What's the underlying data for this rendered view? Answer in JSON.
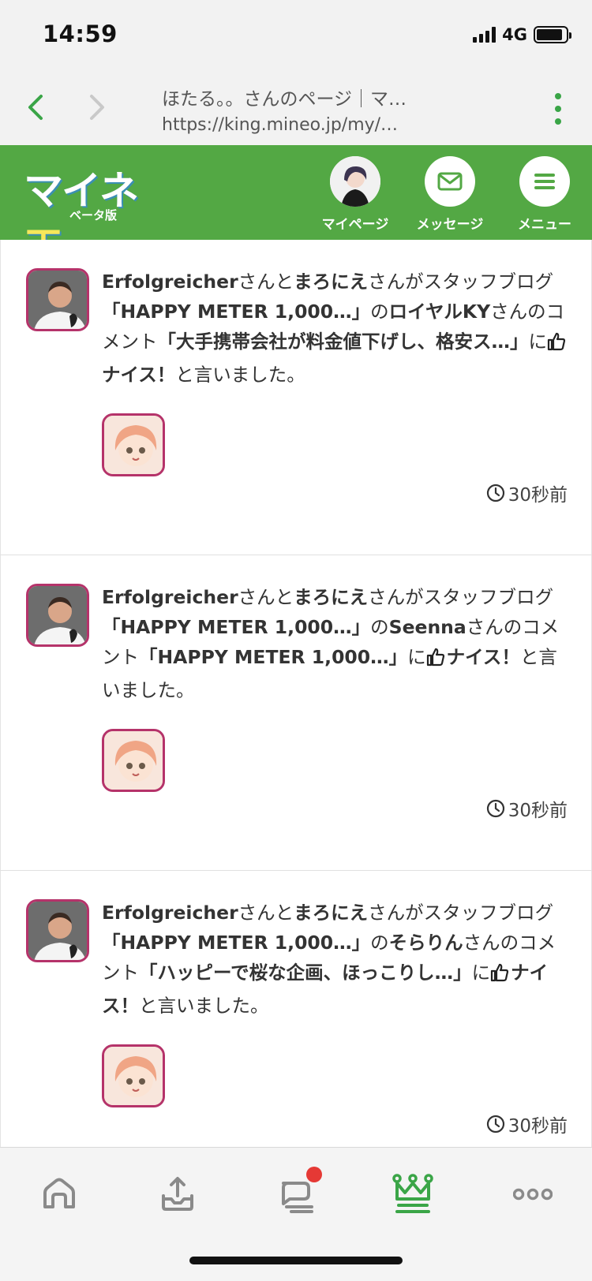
{
  "status": {
    "time": "14:59",
    "network": "4G"
  },
  "browser": {
    "page_title": "ほたる。。さんのページ｜マ…",
    "url": "https://king.mineo.jp/my/…"
  },
  "header": {
    "logo_text_a": "マイネ",
    "logo_text_b": "王",
    "logo_sub": "ベータ版",
    "mypage_label": "マイページ",
    "message_label": "メッセージ",
    "menu_label": "メニュー"
  },
  "feed": [
    {
      "actor1": "Erfolgreicher",
      "t1": "さんと",
      "actor2": "まろにえ",
      "t2": "さんがスタッフブログ",
      "blog": "「HAPPY METER 1,000…」",
      "t3": "の",
      "commenter": "ロイヤルKY",
      "t4": "さんのコメント",
      "comment": "「大手携帯会社が料金値下げし、格安ス…」",
      "t5": "に",
      "nice": "ナイス！",
      "t6": "と言いました。",
      "time": "30秒前"
    },
    {
      "actor1": "Erfolgreicher",
      "t1": "さんと",
      "actor2": "まろにえ",
      "t2": "さんがスタッフブログ",
      "blog": "「HAPPY METER 1,000…」",
      "t3": "の",
      "commenter": "Seenna",
      "t4": "さんのコメント",
      "comment": "「HAPPY METER 1,000…」",
      "t5": "に",
      "nice": "ナイス！",
      "t6": "と言いました。",
      "time": "30秒前"
    },
    {
      "actor1": "Erfolgreicher",
      "t1": "さんと",
      "actor2": "まろにえ",
      "t2": "さんがスタッフブログ",
      "blog": "「HAPPY METER 1,000…」",
      "t3": "の",
      "commenter": "そらりん",
      "t4": "さんのコメント",
      "comment": "「ハッピーで桜な企画、ほっこりし…」",
      "t5": "に",
      "nice": "ナイス！",
      "t6": "と言いました。",
      "time": "30秒前"
    }
  ],
  "tabs": [
    {
      "icon": "home-icon"
    },
    {
      "icon": "upload-tray-icon"
    },
    {
      "icon": "chat-icon",
      "has_badge": true
    },
    {
      "icon": "crown-icon",
      "active": true
    },
    {
      "icon": "more-icon"
    }
  ],
  "colors": {
    "brand_green": "#53a844",
    "accent_green": "#3aa547",
    "avatar_border": "#b5336a",
    "badge_red": "#e53935"
  }
}
